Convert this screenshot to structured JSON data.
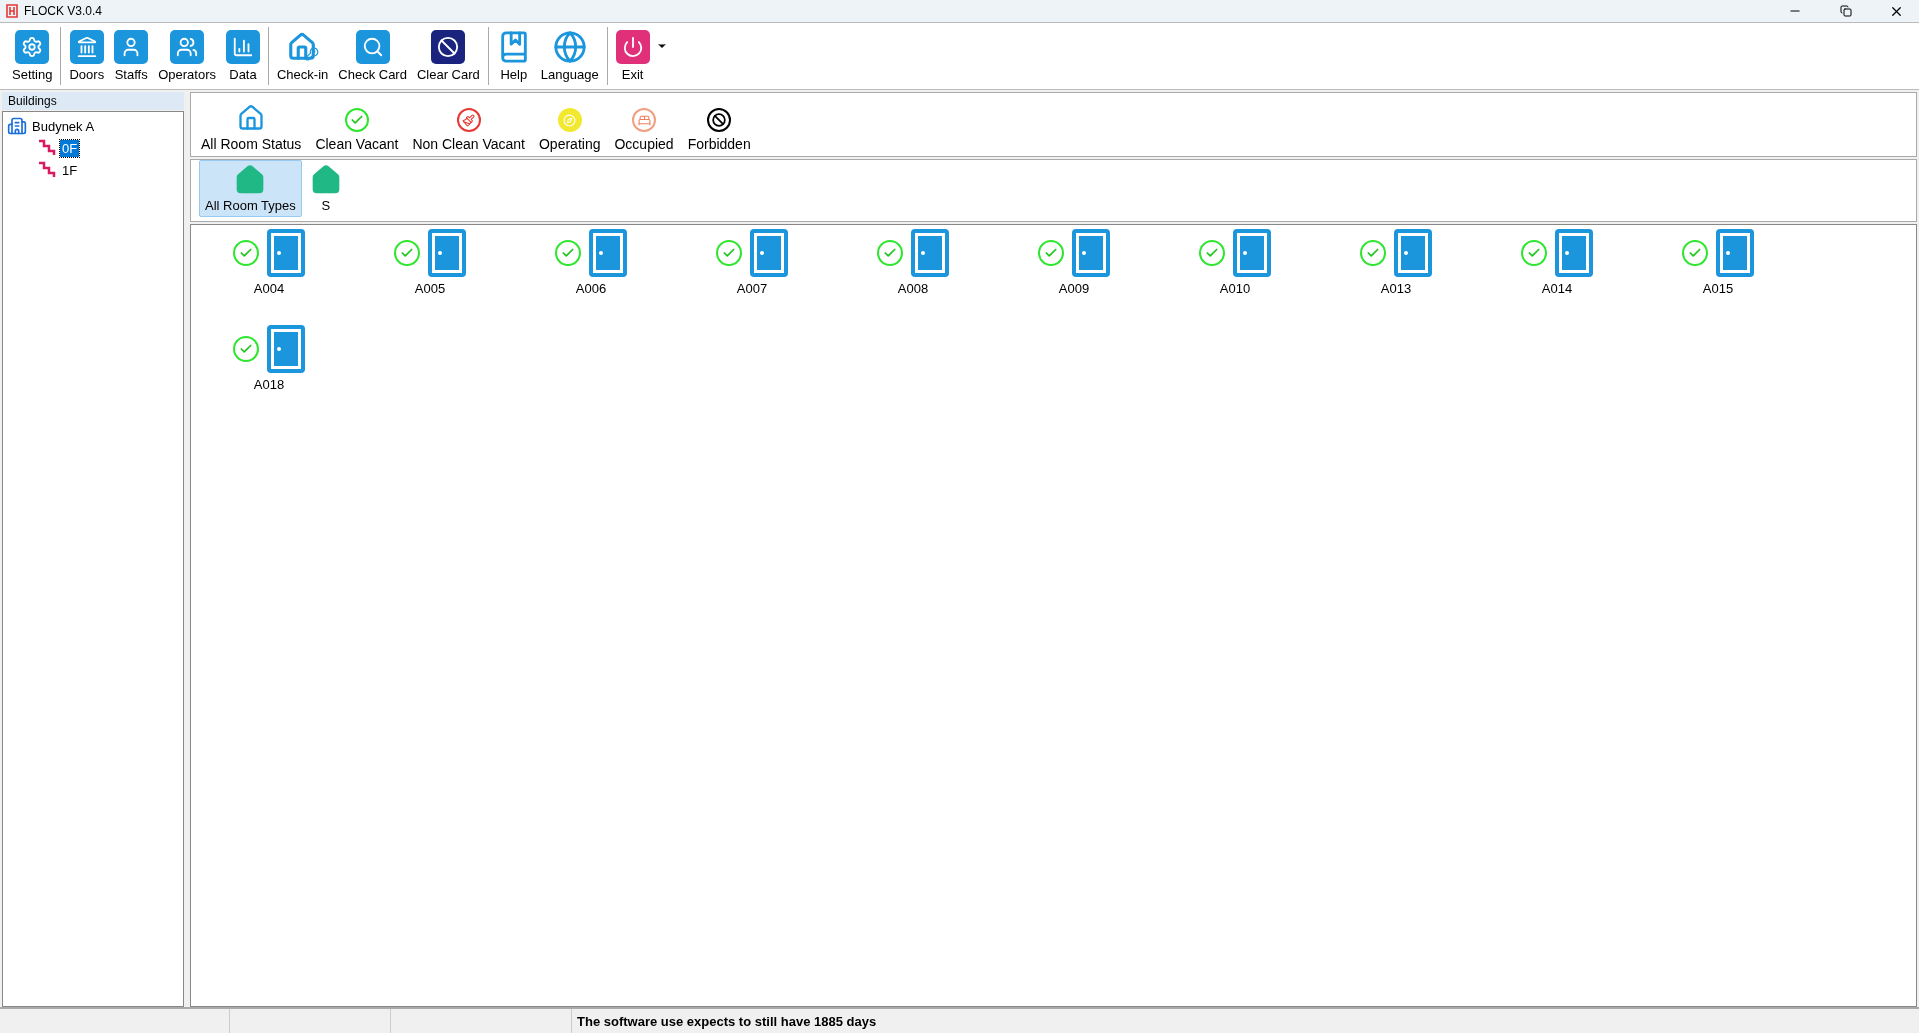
{
  "window": {
    "title": "FLOCK V3.0.4"
  },
  "toolbar": [
    [
      {
        "label": "Setting",
        "kind": "settings"
      }
    ],
    [
      {
        "label": "Doors",
        "kind": "doors"
      },
      {
        "label": "Staffs",
        "kind": "staffs"
      },
      {
        "label": "Operators",
        "kind": "operators"
      },
      {
        "label": "Data",
        "kind": "data"
      }
    ],
    [
      {
        "label": "Check-in",
        "kind": "checkin"
      },
      {
        "label": "Check Card",
        "kind": "checkcard"
      },
      {
        "label": "Clear Card",
        "kind": "clearcard"
      }
    ],
    [
      {
        "label": "Help",
        "kind": "help"
      },
      {
        "label": "Language",
        "kind": "language"
      }
    ],
    [
      {
        "label": "Exit",
        "kind": "exit"
      }
    ]
  ],
  "sidebar": {
    "title": "Buildings",
    "tree": [
      {
        "label": "Budynek A",
        "selected": false,
        "children": [
          {
            "label": "0F",
            "selected": true
          },
          {
            "label": "1F",
            "selected": false
          }
        ]
      }
    ]
  },
  "status_filters": [
    {
      "label": "All Room Status",
      "kind": "all"
    },
    {
      "label": "Clean Vacant",
      "kind": "clean"
    },
    {
      "label": "Non Clean Vacant",
      "kind": "dirty"
    },
    {
      "label": "Operating",
      "kind": "operating"
    },
    {
      "label": "Occupied",
      "kind": "occupied"
    },
    {
      "label": "Forbidden",
      "kind": "forbidden"
    }
  ],
  "room_types": [
    {
      "label": "All Room Types",
      "selected": true
    },
    {
      "label": "S",
      "selected": false
    }
  ],
  "rooms": [
    {
      "name": "A004",
      "kind": "clean"
    },
    {
      "name": "A005",
      "kind": "clean"
    },
    {
      "name": "A006",
      "kind": "clean"
    },
    {
      "name": "A007",
      "kind": "clean"
    },
    {
      "name": "A008",
      "kind": "clean"
    },
    {
      "name": "A009",
      "kind": "clean"
    },
    {
      "name": "A010",
      "kind": "clean"
    },
    {
      "name": "A013",
      "kind": "clean"
    },
    {
      "name": "A014",
      "kind": "clean"
    },
    {
      "name": "A015",
      "kind": "clean"
    },
    {
      "name": "A018",
      "kind": "clean"
    }
  ],
  "status_bar": {
    "message": "The software use expects to still have 1885 days"
  }
}
